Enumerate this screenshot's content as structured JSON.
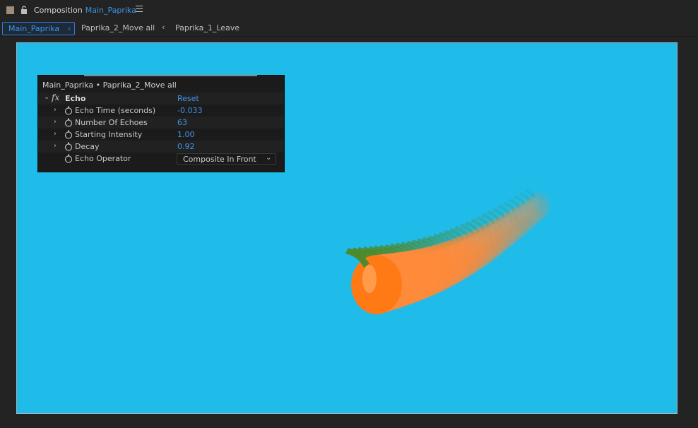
{
  "header": {
    "panel_label": "Composition",
    "composition_name": "Main_Paprika",
    "menu_icon": "hamburger-icon"
  },
  "breadcrumbs": {
    "items": [
      "Main_Paprika",
      "Paprika_2_Move all",
      "Paprika_1_Leave"
    ],
    "separator": "‹"
  },
  "viewer": {
    "background_color": "#1fbbe9"
  },
  "effect_panel": {
    "title": "Main_Paprika • Paprika_2_Move all",
    "effect_name": "Echo",
    "reset_label": "Reset",
    "fx_icon": "fx",
    "properties": [
      {
        "name": "Echo Time (seconds)",
        "value": "-0.033"
      },
      {
        "name": "Number Of Echoes",
        "value": "63"
      },
      {
        "name": "Starting Intensity",
        "value": "1.00"
      },
      {
        "name": "Decay",
        "value": "0.92"
      }
    ],
    "operator": {
      "name": "Echo Operator",
      "value": "Composite In Front"
    }
  },
  "colors": {
    "accent": "#3d93e8",
    "panel_bg": "#1b1b1b",
    "app_bg": "#232323"
  }
}
